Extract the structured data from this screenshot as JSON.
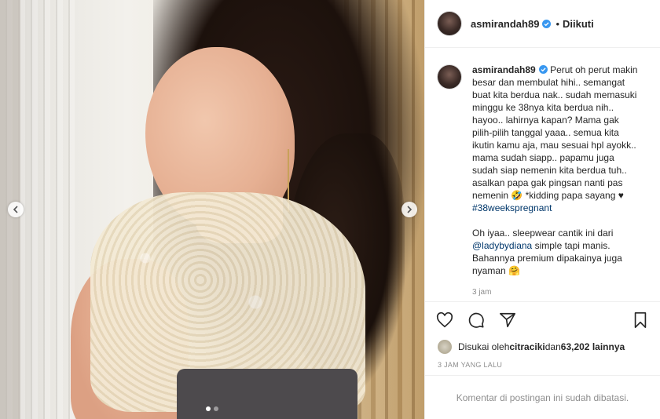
{
  "post": {
    "username": "asmirandah89",
    "follow_status": "Diikuti",
    "header_separator": "•",
    "caption": {
      "part1": "Perut oh perut makin besar dan membulat hihi.. semangat buat kita berdua nak.. sudah memasuki minggu ke 38nya kita berdua nih.. hayoo.. lahirnya kapan? Mama gak pilih-pilih tanggal yaaa.. semua kita ikutin kamu aja, mau sesuai hpl ayokk.. mama sudah siapp.. papamu juga sudah siap nemenin kita berdua tuh.. asalkan papa gak pingsan nanti pas nemenin 🤣 *kidding papa sayang ♥ ",
      "hashtag": "#38weekspregnant",
      "part2_before": "Oh iyaa.. sleepwear cantik ini dari ",
      "mention": "@ladybydiana",
      "part2_after": " simple tapi manis. Bahannya premium dipakainya juga nyaman 🤗",
      "time": "3 jam"
    },
    "likes": {
      "prefix": "Disukai oleh ",
      "user": "citraciki",
      "middle": " dan ",
      "count": "63,202 lainnya"
    },
    "timestamp": "3 JAM YANG LALU",
    "comments_disabled": "Komentar di postingan ini sudah dibatasi.",
    "carousel": {
      "total_slides": 2,
      "active_slide": 1
    }
  },
  "colors": {
    "verified": "#3897f0",
    "link": "#00376b",
    "muted": "#8e8e8e",
    "border": "#efefef"
  },
  "icons": [
    "heart-icon",
    "comment-icon",
    "share-icon",
    "bookmark-icon",
    "verified-badge-icon",
    "chevron-left-icon",
    "chevron-right-icon"
  ]
}
